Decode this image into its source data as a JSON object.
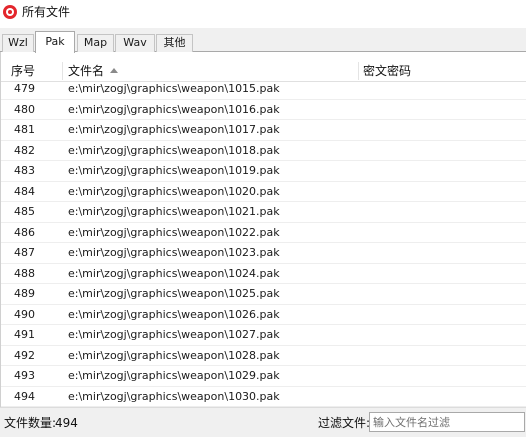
{
  "window": {
    "title": "所有文件",
    "icon": "app-logo-icon",
    "accent_color": "#e3262c"
  },
  "tabs": [
    {
      "label": "Wzl",
      "active": false
    },
    {
      "label": "Pak",
      "active": true
    },
    {
      "label": "Map",
      "active": false
    },
    {
      "label": "Wav",
      "active": false
    },
    {
      "label": "其他",
      "active": false
    }
  ],
  "table": {
    "columns": {
      "seq": "序号",
      "name": "文件名",
      "password": "密文密码"
    },
    "sort": {
      "column": "name",
      "direction": "ascending",
      "icon": "sort-up-icon"
    },
    "rows": [
      {
        "seq": "479",
        "name": "e:\\mir\\zogj\\graphics\\weapon\\1015.pak",
        "password": ""
      },
      {
        "seq": "480",
        "name": "e:\\mir\\zogj\\graphics\\weapon\\1016.pak",
        "password": ""
      },
      {
        "seq": "481",
        "name": "e:\\mir\\zogj\\graphics\\weapon\\1017.pak",
        "password": ""
      },
      {
        "seq": "482",
        "name": "e:\\mir\\zogj\\graphics\\weapon\\1018.pak",
        "password": ""
      },
      {
        "seq": "483",
        "name": "e:\\mir\\zogj\\graphics\\weapon\\1019.pak",
        "password": ""
      },
      {
        "seq": "484",
        "name": "e:\\mir\\zogj\\graphics\\weapon\\1020.pak",
        "password": ""
      },
      {
        "seq": "485",
        "name": "e:\\mir\\zogj\\graphics\\weapon\\1021.pak",
        "password": ""
      },
      {
        "seq": "486",
        "name": "e:\\mir\\zogj\\graphics\\weapon\\1022.pak",
        "password": ""
      },
      {
        "seq": "487",
        "name": "e:\\mir\\zogj\\graphics\\weapon\\1023.pak",
        "password": ""
      },
      {
        "seq": "488",
        "name": "e:\\mir\\zogj\\graphics\\weapon\\1024.pak",
        "password": ""
      },
      {
        "seq": "489",
        "name": "e:\\mir\\zogj\\graphics\\weapon\\1025.pak",
        "password": ""
      },
      {
        "seq": "490",
        "name": "e:\\mir\\zogj\\graphics\\weapon\\1026.pak",
        "password": ""
      },
      {
        "seq": "491",
        "name": "e:\\mir\\zogj\\graphics\\weapon\\1027.pak",
        "password": ""
      },
      {
        "seq": "492",
        "name": "e:\\mir\\zogj\\graphics\\weapon\\1028.pak",
        "password": ""
      },
      {
        "seq": "493",
        "name": "e:\\mir\\zogj\\graphics\\weapon\\1029.pak",
        "password": ""
      },
      {
        "seq": "494",
        "name": "e:\\mir\\zogj\\graphics\\weapon\\1030.pak",
        "password": ""
      }
    ]
  },
  "status": {
    "count_label": "文件数量:",
    "count_value": "494",
    "filter_label": "过滤文件:",
    "filter_placeholder": "输入文件名过滤",
    "filter_value": ""
  }
}
